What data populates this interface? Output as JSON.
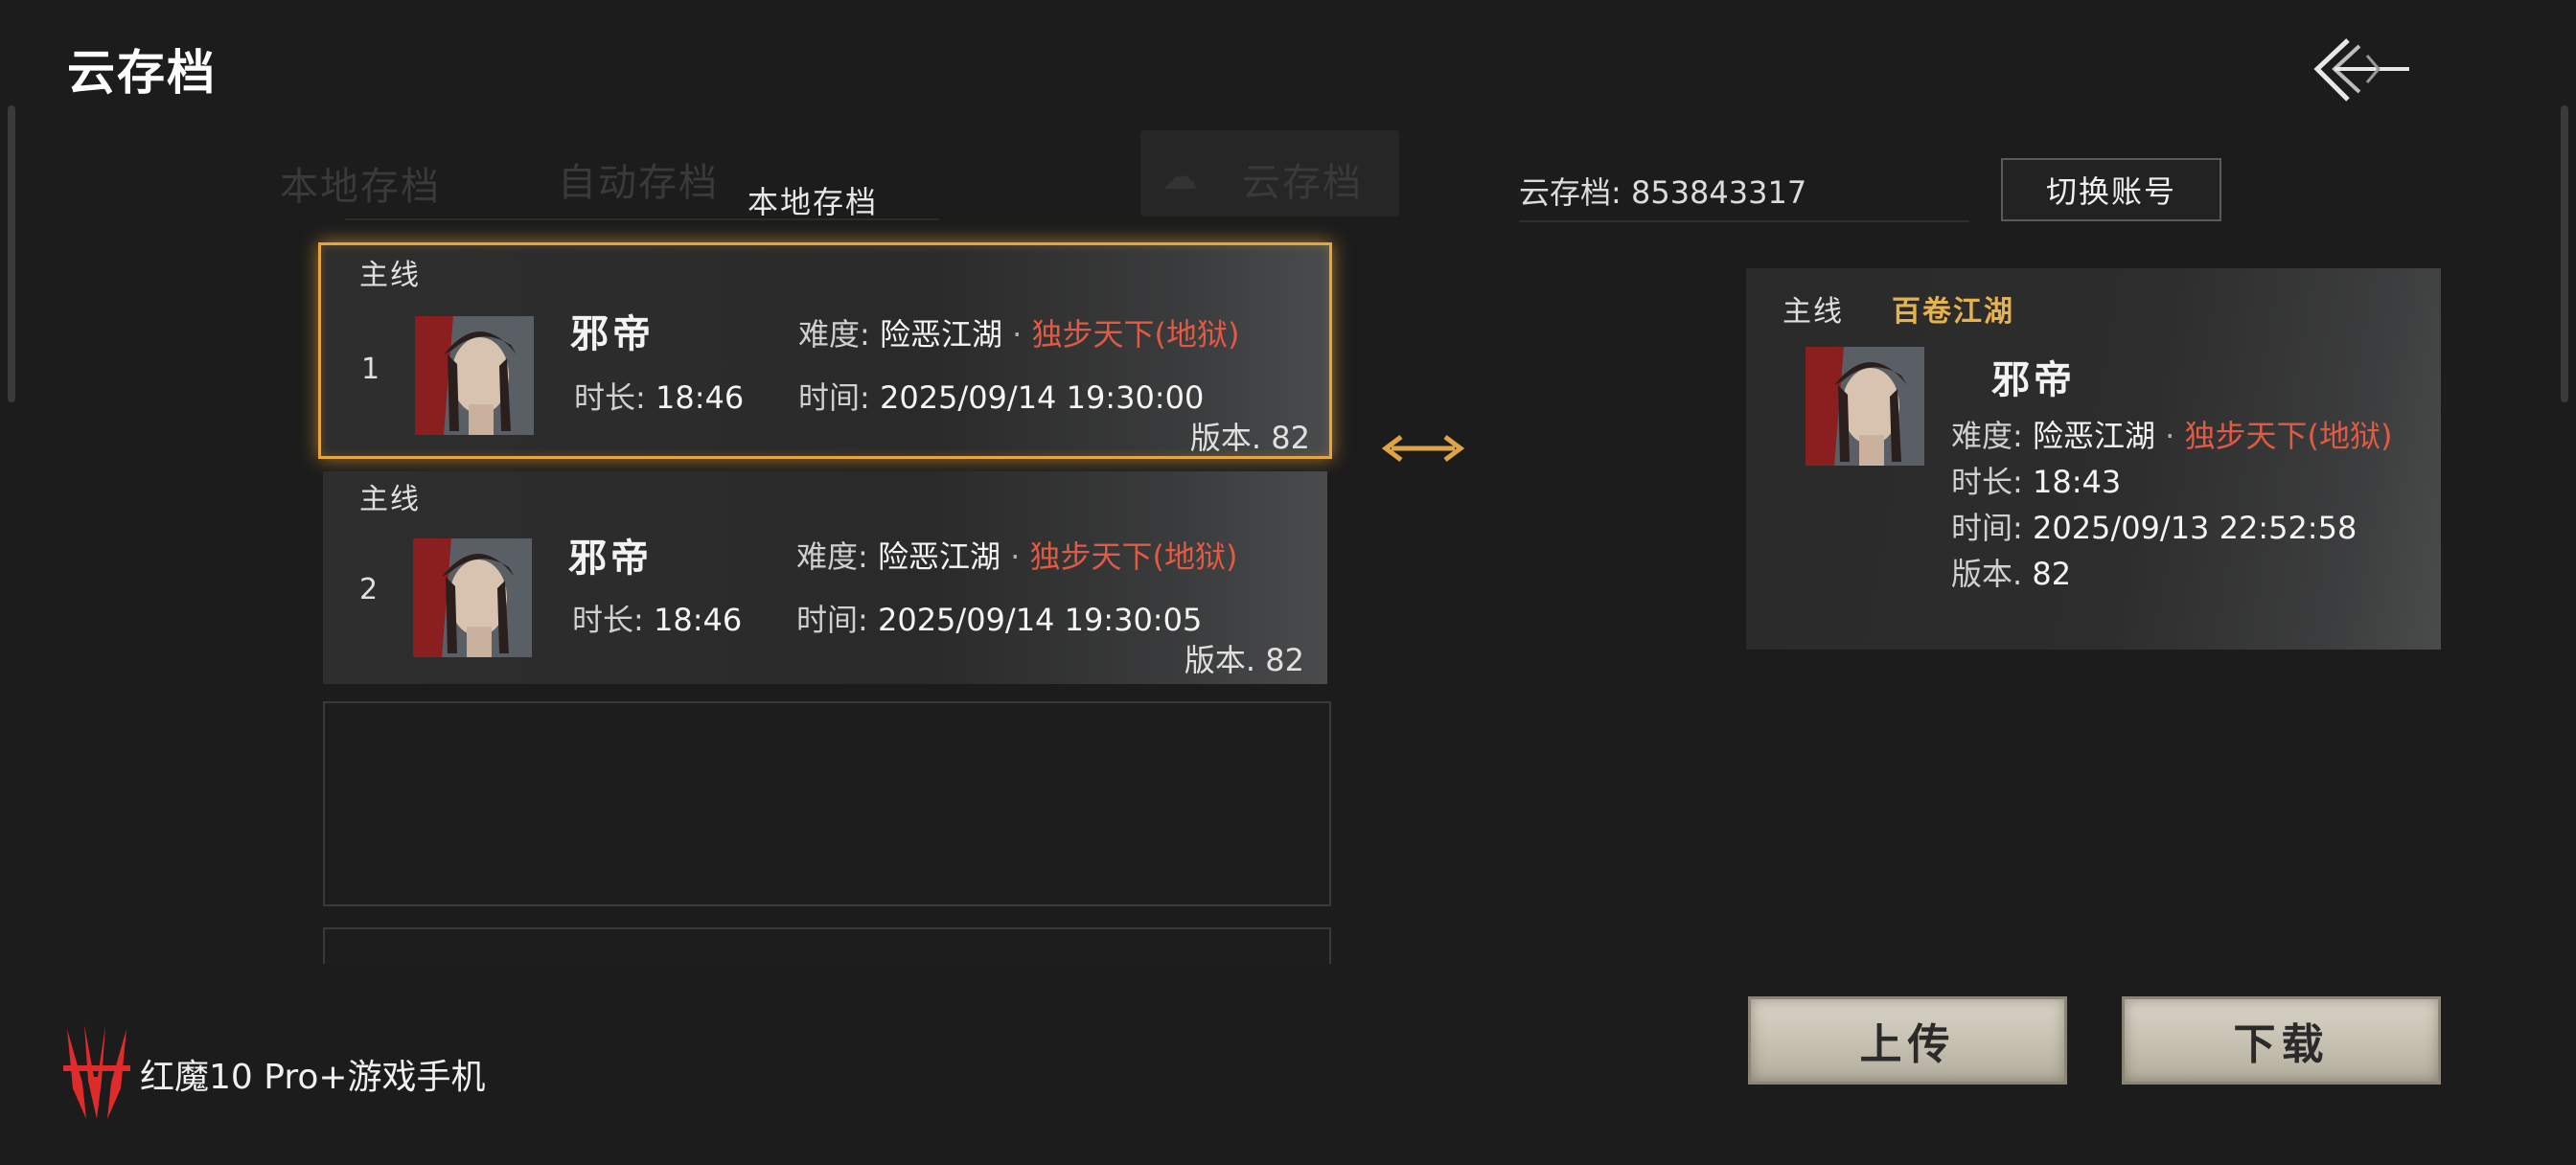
{
  "header": {
    "title": "云存档"
  },
  "tabs": {
    "ghost_local": "本地存档",
    "ghost_auto": "自动存档",
    "ghost_cloud": "云存档",
    "current_section": "本地存档"
  },
  "local_saves": [
    {
      "chapter": "主线",
      "index": "1",
      "name": "邪帝",
      "difficulty_label": "难度:",
      "difficulty_value": "险恶江湖",
      "difficulty_sep": "·",
      "difficulty_extra": "独步天下(地狱)",
      "duration_label": "时长:",
      "duration_value": "18:46",
      "time_label": "时间:",
      "time_value": "2025/09/14 19:30:00",
      "version": "版本. 82",
      "selected": true
    },
    {
      "chapter": "主线",
      "index": "2",
      "name": "邪帝",
      "difficulty_label": "难度:",
      "difficulty_value": "险恶江湖",
      "difficulty_sep": "·",
      "difficulty_extra": "独步天下(地狱)",
      "duration_label": "时长:",
      "duration_value": "18:46",
      "time_label": "时间:",
      "time_value": "2025/09/14 19:30:05",
      "version": "版本. 82",
      "selected": false
    }
  ],
  "cloud": {
    "account_label": "云存档:",
    "account_id": "853843317",
    "switch_account": "切换账号",
    "save": {
      "chapter": "主线",
      "subtitle": "百卷江湖",
      "name": "邪帝",
      "difficulty_label": "难度:",
      "difficulty_value": "险恶江湖",
      "difficulty_sep": "·",
      "difficulty_extra": "独步天下(地狱)",
      "duration_label": "时长:",
      "duration_value": "18:43",
      "time_label": "时间:",
      "time_value": "2025/09/13 22:52:58",
      "version_label": "版本.",
      "version_value": "82"
    }
  },
  "actions": {
    "upload": "上传",
    "download": "下载"
  },
  "brand": {
    "text": "红魔10 Pro+游戏手机"
  },
  "colors": {
    "accent_gold": "#e8a63a",
    "difficulty_red": "#e05a44",
    "subtitle_gold": "#e6b24e"
  }
}
